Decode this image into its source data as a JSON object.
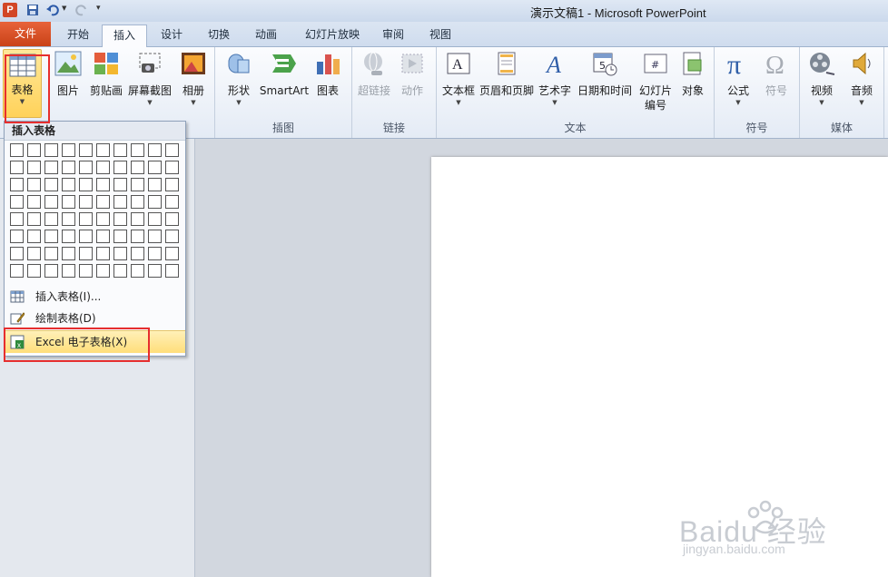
{
  "window": {
    "title": "演示文稿1 - Microsoft PowerPoint"
  },
  "tabs": [
    "文件",
    "开始",
    "插入",
    "设计",
    "切换",
    "动画",
    "幻灯片放映",
    "审阅",
    "视图"
  ],
  "ribbon": {
    "groups": {
      "illustrations": "插图",
      "links": "链接",
      "text": "文本",
      "symbols": "符号",
      "media": "媒体"
    },
    "buttons": {
      "table": "表格",
      "picture": "图片",
      "clipart": "剪贴画",
      "screenshot": "屏幕截图",
      "album": "相册",
      "shapes": "形状",
      "smartart": "SmartArt",
      "chart": "图表",
      "hyperlink": "超链接",
      "action": "动作",
      "textbox": "文本框",
      "header_footer": "页眉和页脚",
      "wordart": "艺术字",
      "datetime": "日期和时间",
      "slide_number_1": "幻灯片",
      "slide_number_2": "编号",
      "object": "对象",
      "equation": "公式",
      "symbol": "符号",
      "video": "视频",
      "audio": "音频"
    }
  },
  "dropdown": {
    "header": "插入表格",
    "grid": {
      "columns": 10,
      "rows": 8
    },
    "items": {
      "insert_table": "插入表格(I)...",
      "draw_table": "绘制表格(D)",
      "excel_table": "Excel 电子表格(X)"
    }
  },
  "watermark": {
    "brand": "Baidu 经验",
    "url": "jingyan.baidu.com"
  },
  "colors": {
    "file_tab": "#d24726",
    "highlight": "#ffd25a",
    "annotation_box": "#e62e2e"
  }
}
